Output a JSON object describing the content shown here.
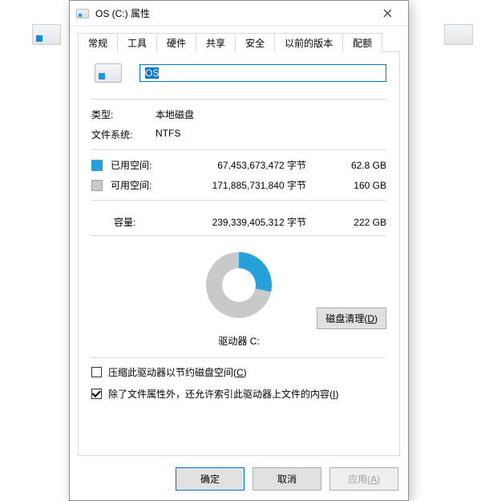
{
  "window": {
    "title": "OS (C:) 属性"
  },
  "tabs": {
    "general": "常规",
    "tools": "工具",
    "hardware": "硬件",
    "sharing": "共享",
    "security": "安全",
    "previous": "以前的版本",
    "quota": "配额"
  },
  "drive_name": "OS",
  "fields": {
    "type_label": "类型:",
    "type_value": "本地磁盘",
    "fs_label": "文件系统:",
    "fs_value": "NTFS",
    "used_label": "已用空间:",
    "used_bytes": "67,453,673,472 字节",
    "used_hr": "62.8 GB",
    "free_label": "可用空间:",
    "free_bytes": "171,885,731,840 字节",
    "free_hr": "160 GB",
    "capacity_label": "容量:",
    "capacity_bytes": "239,339,405,312 字节",
    "capacity_hr": "222 GB",
    "drive_letter": "驱动器 C:"
  },
  "buttons": {
    "cleanup": "磁盘清理(D)",
    "ok": "确定",
    "cancel": "取消",
    "apply": "应用(A)"
  },
  "checkboxes": {
    "compress": "压缩此驱动器以节约磁盘空间(C)",
    "index": "除了文件属性外，还允许索引此驱动器上文件的内容(I)"
  },
  "chart_data": {
    "type": "pie",
    "title": "驱动器 C:",
    "series": [
      {
        "name": "已用空间",
        "value": 67453673472,
        "hr": "62.8 GB",
        "color": "#26a0da"
      },
      {
        "name": "可用空间",
        "value": 171885731840,
        "hr": "160 GB",
        "color": "#c9c9c9"
      }
    ],
    "total": {
      "value": 239339405312,
      "hr": "222 GB"
    }
  }
}
